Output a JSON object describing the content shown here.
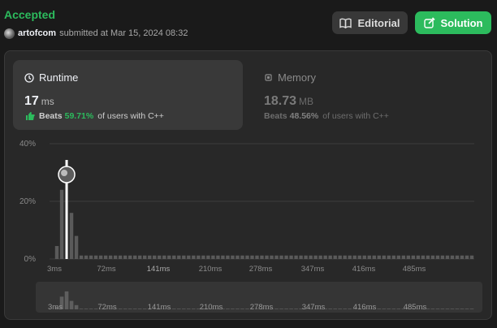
{
  "header": {
    "status": "Accepted",
    "user": "artofcom",
    "submitted_text": "submitted at Mar 15, 2024 08:32"
  },
  "buttons": {
    "editorial": "Editorial",
    "solution": "Solution"
  },
  "metrics": {
    "runtime": {
      "title": "Runtime",
      "value": "17",
      "unit": "ms",
      "beats_label": "Beats",
      "beats_pct": "59.71%",
      "beats_suffix": "of users with C++"
    },
    "memory": {
      "title": "Memory",
      "value": "18.73",
      "unit": "MB",
      "beats_label": "Beats",
      "beats_pct": "48.56%",
      "beats_suffix": "of users with C++"
    }
  },
  "colors": {
    "accent": "#2cbb5d",
    "background": "#1a1a1a",
    "card": "#282828"
  },
  "chart_data": {
    "type": "bar",
    "yticks": [
      "40%",
      "20%",
      "0%"
    ],
    "ylim": [
      0,
      40
    ],
    "xticks": [
      "3ms",
      "72ms",
      "141ms",
      "210ms",
      "278ms",
      "347ms",
      "416ms",
      "485ms"
    ],
    "highlight_label": "17ms",
    "values": [
      0,
      4.5,
      24,
      34,
      16,
      8,
      1.2,
      1.2,
      1.2,
      1.2,
      1.2,
      1.2,
      1.2,
      1.2,
      1.2,
      1.2,
      1.2,
      1.2,
      1.2,
      1.2,
      1.2,
      1.2,
      1.2,
      1.2,
      1.2,
      1.2,
      1.2,
      1.2,
      1.2,
      1.2,
      1.2,
      1.2,
      1.2,
      1.2,
      1.2,
      1.2,
      1.2,
      1.2,
      1.2,
      1.2,
      1.2,
      1.2,
      1.2,
      1.2,
      1.2,
      1.2,
      1.2,
      1.2,
      1.2,
      1.2,
      1.2,
      1.2,
      1.2,
      1.2,
      1.2,
      1.2,
      1.2,
      1.2,
      1.2,
      1.2,
      1.2,
      1.2,
      1.2,
      1.2,
      1.2,
      1.2,
      1.2,
      1.2,
      1.2,
      1.2,
      1.2,
      1.2,
      1.2,
      1.2,
      1.2,
      1.2,
      1.2,
      1.2,
      1.2,
      1.2,
      1.2,
      1.2,
      1.2,
      1.2,
      1.2,
      1.2,
      1.2
    ],
    "highlight_index": 3,
    "grid": true,
    "minimap": true
  }
}
